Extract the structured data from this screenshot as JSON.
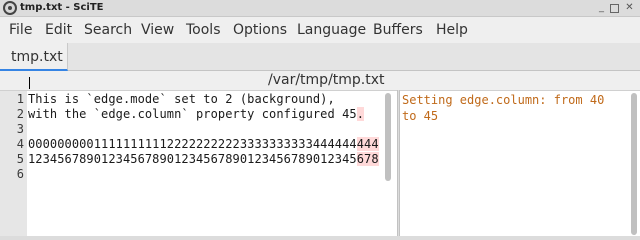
{
  "window": {
    "title": "tmp.txt - SciTE"
  },
  "menu": [
    "File",
    "Edit",
    "Search",
    "View",
    "Tools",
    "Options",
    "Language",
    "Buffers",
    "Help"
  ],
  "tab": {
    "label": "tmp.txt"
  },
  "path": "/var/tmp/tmp.txt",
  "editor": {
    "line_numbers": [
      "1",
      "2",
      "3",
      "4",
      "5",
      "6"
    ],
    "lines": [
      {
        "main": "This is `edge.mode` set to 2 (background),",
        "edge": ""
      },
      {
        "main": "with the `edge.column` property configured 45",
        "edge": "."
      },
      {
        "main": "",
        "edge": ""
      },
      {
        "main": "000000000111111111122222222223333333333444444",
        "edge": "444"
      },
      {
        "main": "123456789012345678901234567890123456789012345",
        "edge": "678"
      },
      {
        "main": "",
        "edge": ""
      }
    ]
  },
  "output": {
    "lines": [
      "Setting edge.column: from 40",
      "to 45"
    ]
  },
  "colors": {
    "edge_background": "#ffd9d9",
    "output_text": "#c06a1a",
    "tab_accent": "#3584e4"
  }
}
